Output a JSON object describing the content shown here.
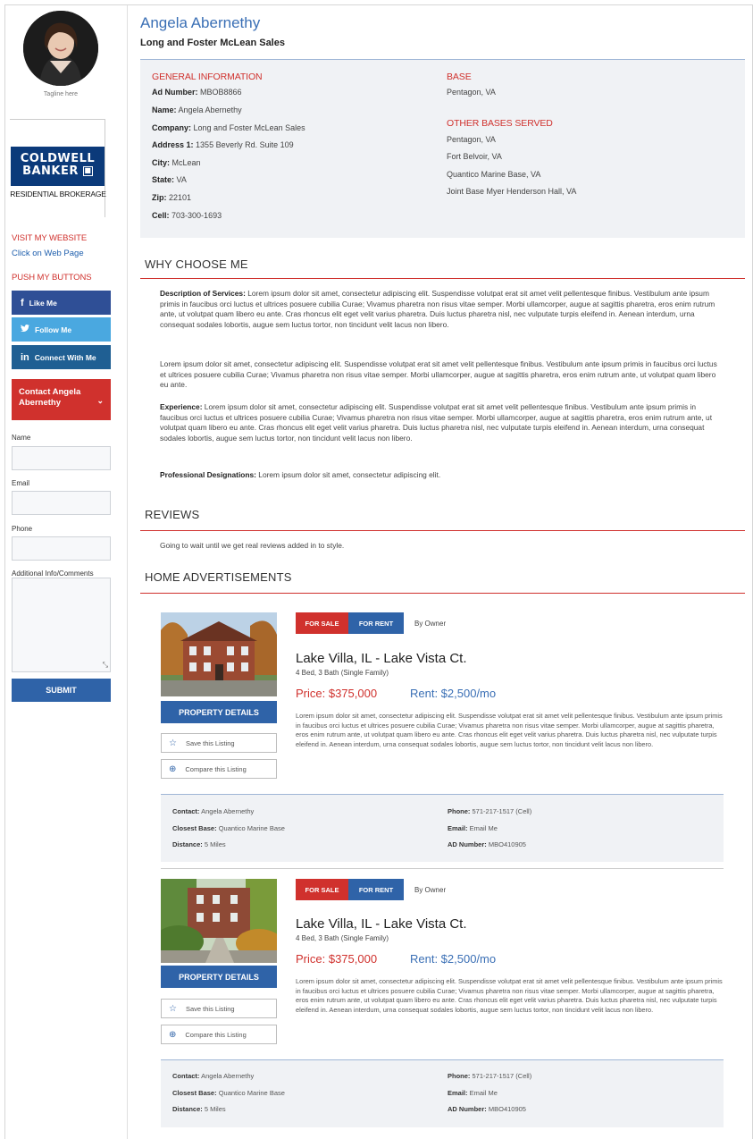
{
  "agent": {
    "name": "Angela Abernethy",
    "company": "Long and Foster McLean Sales",
    "tagline": "Tagline here"
  },
  "brand": {
    "logo_line1": "COLDWELL",
    "logo_line2": "BANKER",
    "sub": "RESIDENTIAL BROKERAGE"
  },
  "sidebar": {
    "visit_title": "VISIT MY WEBSITE",
    "web_link": "Click on Web Page",
    "push_title": "PUSH MY BUTTONS",
    "social": [
      {
        "label": "Like Me",
        "icon": "facebook-icon",
        "glyph": "f",
        "color": "#2f4f96"
      },
      {
        "label": "Follow Me",
        "icon": "twitter-icon",
        "glyph": "🐦",
        "color": "#4aa8e0"
      },
      {
        "label": "Connect With Me",
        "icon": "linkedin-icon",
        "glyph": "in",
        "color": "#1f5f93"
      }
    ],
    "contact_button": "Contact Angela Abernethy",
    "form": {
      "name_label": "Name",
      "email_label": "Email",
      "phone_label": "Phone",
      "comments_label": "Additional Info/Comments",
      "submit": "SUBMIT"
    }
  },
  "general": {
    "title": "GENERAL INFORMATION",
    "fields": [
      {
        "label": "Ad Number:",
        "value": "MBOB8866"
      },
      {
        "label": "Name:",
        "value": "Angela Abernethy"
      },
      {
        "label": "Company:",
        "value": "Long and Foster McLean Sales"
      },
      {
        "label": "Address 1:",
        "value": "1355 Beverly Rd. Suite 109"
      },
      {
        "label": "City:",
        "value": "McLean"
      },
      {
        "label": "State:",
        "value": "VA"
      },
      {
        "label": "Zip:",
        "value": "22101"
      },
      {
        "label": "Cell:",
        "value": "703-300-1693"
      }
    ]
  },
  "base": {
    "title": "BASE",
    "value": "Pentagon, VA",
    "other_title": "OTHER BASES SERVED",
    "others": [
      "Pentagon, VA",
      "Fort Belvoir, VA",
      "Quantico Marine Base, VA",
      "Joint Base Myer Henderson Hall, VA"
    ]
  },
  "why": {
    "title": "WHY CHOOSE ME",
    "p1_label": "Description of Services:",
    "p1": " Lorem ipsum dolor sit amet, consectetur adipiscing elit. Suspendisse volutpat erat sit amet velit pellentesque finibus. Vestibulum ante ipsum primis in faucibus orci luctus et ultrices posuere cubilia Curae; Vivamus pharetra non risus vitae semper. Morbi ullamcorper, augue at sagittis pharetra, eros enim rutrum ante, ut volutpat quam libero eu ante. Cras rhoncus elit eget velit varius pharetra. Duis luctus pharetra nisl, nec vulputate turpis eleifend in. Aenean interdum, urna consequat sodales lobortis, augue sem luctus tortor, non tincidunt velit lacus non libero.",
    "p2": "Lorem ipsum dolor sit amet, consectetur adipiscing elit. Suspendisse volutpat erat sit amet velit pellentesque finibus. Vestibulum ante ipsum primis in faucibus orci luctus et ultrices posuere cubilia Curae; Vivamus pharetra non risus vitae semper. Morbi ullamcorper, augue at sagittis pharetra, eros enim rutrum ante, ut volutpat quam libero eu ante.",
    "p3_label": "Experience:",
    "p3": " Lorem ipsum dolor sit amet, consectetur adipiscing elit. Suspendisse volutpat erat sit amet velit pellentesque finibus. Vestibulum ante ipsum primis in faucibus orci luctus et ultrices posuere cubilia Curae; Vivamus pharetra non risus vitae semper. Morbi ullamcorper, augue at sagittis pharetra, eros enim rutrum ante, ut volutpat quam libero eu ante. Cras rhoncus elit eget velit varius pharetra. Duis luctus pharetra nisl, nec vulputate turpis eleifend in. Aenean interdum, urna consequat sodales lobortis, augue sem luctus tortor, non tincidunt velit lacus non libero.",
    "p4_label": "Professional Designations:",
    "p4": " Lorem ipsum dolor sit amet, consectetur adipiscing elit."
  },
  "reviews": {
    "title": "REVIEWS",
    "text": "Going to wait until we get real reviews added in to style."
  },
  "ads": {
    "title": "HOME ADVERTISEMENTS",
    "listings": [
      {
        "tag_sale": "FOR SALE",
        "tag_rent": "FOR RENT",
        "tag_owner": "By Owner",
        "title": "Lake Villa, IL - Lake Vista Ct.",
        "sub": "4 Bed, 3 Bath (Single Family)",
        "price": "Price: $375,000",
        "rent": "Rent: $2,500/mo",
        "desc": "Lorem ipsum dolor sit amet, consectetur adipiscing elit. Suspendisse volutpat erat sit amet velit pellentesque finibus. Vestibulum ante ipsum primis in faucibus orci luctus et ultrices posuere cubilia Curae; Vivamus pharetra non risus vitae semper. Morbi ullamcorper, augue at sagittis pharetra, eros enim rutrum ante, ut volutpat quam libero eu ante. Cras rhoncus elit eget velit varius pharetra. Duis luctus pharetra nisl, nec vulputate turpis eleifend in. Aenean interdum, urna consequat sodales lobortis, augue sem luctus tortor, non tincidunt velit lacus non libero.",
        "details_btn": "PROPERTY DETAILS",
        "save_btn": "Save this Listing",
        "compare_btn": "Compare this Listing",
        "contact_label": "Contact:",
        "contact": "Angela Abernethy",
        "base_label": "Closest Base:",
        "base": "Quantico Marine Base",
        "distance_label": "Distance:",
        "distance": "5 Miles",
        "phone_label": "Phone:",
        "phone": "571-217-1517 (Cell)",
        "email_label": "Email:",
        "email": "Email Me",
        "ad_label": "AD Number:",
        "ad": "MBO410905"
      },
      {
        "tag_sale": "FOR SALE",
        "tag_rent": "FOR RENT",
        "tag_owner": "By Owner",
        "title": "Lake Villa, IL - Lake Vista Ct.",
        "sub": "4 Bed, 3 Bath (Single Family)",
        "price": "Price: $375,000",
        "rent": "Rent: $2,500/mo",
        "desc": "Lorem ipsum dolor sit amet, consectetur adipiscing elit. Suspendisse volutpat erat sit amet velit pellentesque finibus. Vestibulum ante ipsum primis in faucibus orci luctus et ultrices posuere cubilia Curae; Vivamus pharetra non risus vitae semper. Morbi ullamcorper, augue at sagittis pharetra, eros enim rutrum ante, ut volutpat quam libero eu ante. Cras rhoncus elit eget velit varius pharetra. Duis luctus pharetra nisl, nec vulputate turpis eleifend in. Aenean interdum, urna consequat sodales lobortis, augue sem luctus tortor, non tincidunt velit lacus non libero.",
        "details_btn": "PROPERTY DETAILS",
        "save_btn": "Save this Listing",
        "compare_btn": "Compare this Listing",
        "contact_label": "Contact:",
        "contact": "Angela Abernethy",
        "base_label": "Closest Base:",
        "base": "Quantico Marine Base",
        "distance_label": "Distance:",
        "distance": "5 Miles",
        "phone_label": "Phone:",
        "phone": "571-217-1517 (Cell)",
        "email_label": "Email:",
        "email": "Email Me",
        "ad_label": "AD Number:",
        "ad": "MBO410905"
      }
    ]
  },
  "colors": {
    "accent_red": "#d0312d",
    "accent_blue": "#2f63a8",
    "panel_bg": "#f0f2f5"
  }
}
